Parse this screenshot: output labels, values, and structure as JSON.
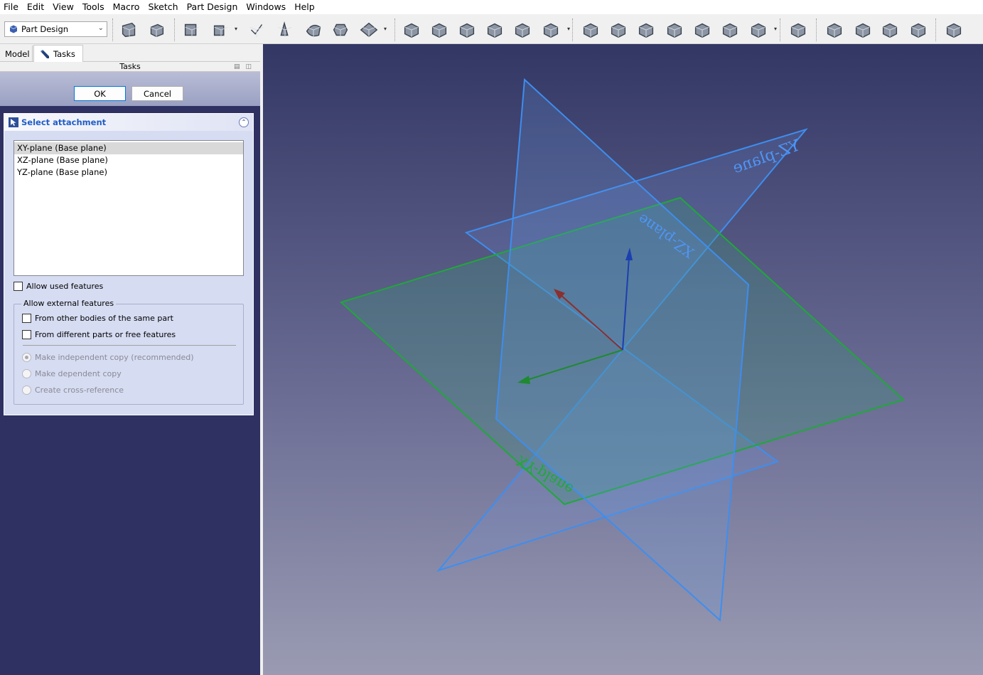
{
  "menu": [
    "File",
    "Edit",
    "View",
    "Tools",
    "Macro",
    "Sketch",
    "Part Design",
    "Windows",
    "Help"
  ],
  "toolbar": {
    "workbench": "Part Design",
    "icons": [
      "part-icon",
      "body-icon",
      "sketch-icon",
      "attach-sketch-icon",
      "validate-sketch-icon",
      "point-icon",
      "shape-binder-icon",
      "clone-icon",
      "datum-plane-icon",
      "pad-icon",
      "revolution-icon",
      "additive-loft-icon",
      "additive-pipe-icon",
      "additive-helix-icon",
      "additive-box-icon",
      "pocket-icon",
      "hole-icon",
      "groove-icon",
      "subtractive-loft-icon",
      "subtractive-pipe-icon",
      "subtractive-helix-icon",
      "subtractive-box-icon",
      "boolean-icon",
      "fillet-icon",
      "chamfer-icon",
      "draft-icon",
      "thickness-icon",
      "mirrored-icon"
    ]
  },
  "tabs": {
    "model": "Model",
    "tasks": "Tasks"
  },
  "tasks_header": "Tasks",
  "dialog": {
    "ok": "OK",
    "cancel": "Cancel"
  },
  "attachment": {
    "title": "Select attachment",
    "items": [
      "XY-plane (Base plane)",
      "XZ-plane (Base plane)",
      "YZ-plane (Base plane)"
    ],
    "selected_index": 0,
    "allow_used": "Allow used features",
    "external_group": "Allow external features",
    "from_other_bodies": "From other bodies of the same part",
    "from_different_parts": "From different parts or free features",
    "radio_independent": "Make independent copy (recommended)",
    "radio_dependent": "Make dependent copy",
    "radio_crossref": "Create cross-reference"
  },
  "viewport": {
    "planes": [
      "YZ-plane",
      "XZ-plane",
      "XY-plane"
    ],
    "colors": {
      "plane_blue": "#3d8ef0",
      "plane_green": "#1fa83a",
      "axis_x": "#8b2f2f",
      "axis_y": "#1f8a2f",
      "axis_z": "#1c3fb0"
    }
  }
}
